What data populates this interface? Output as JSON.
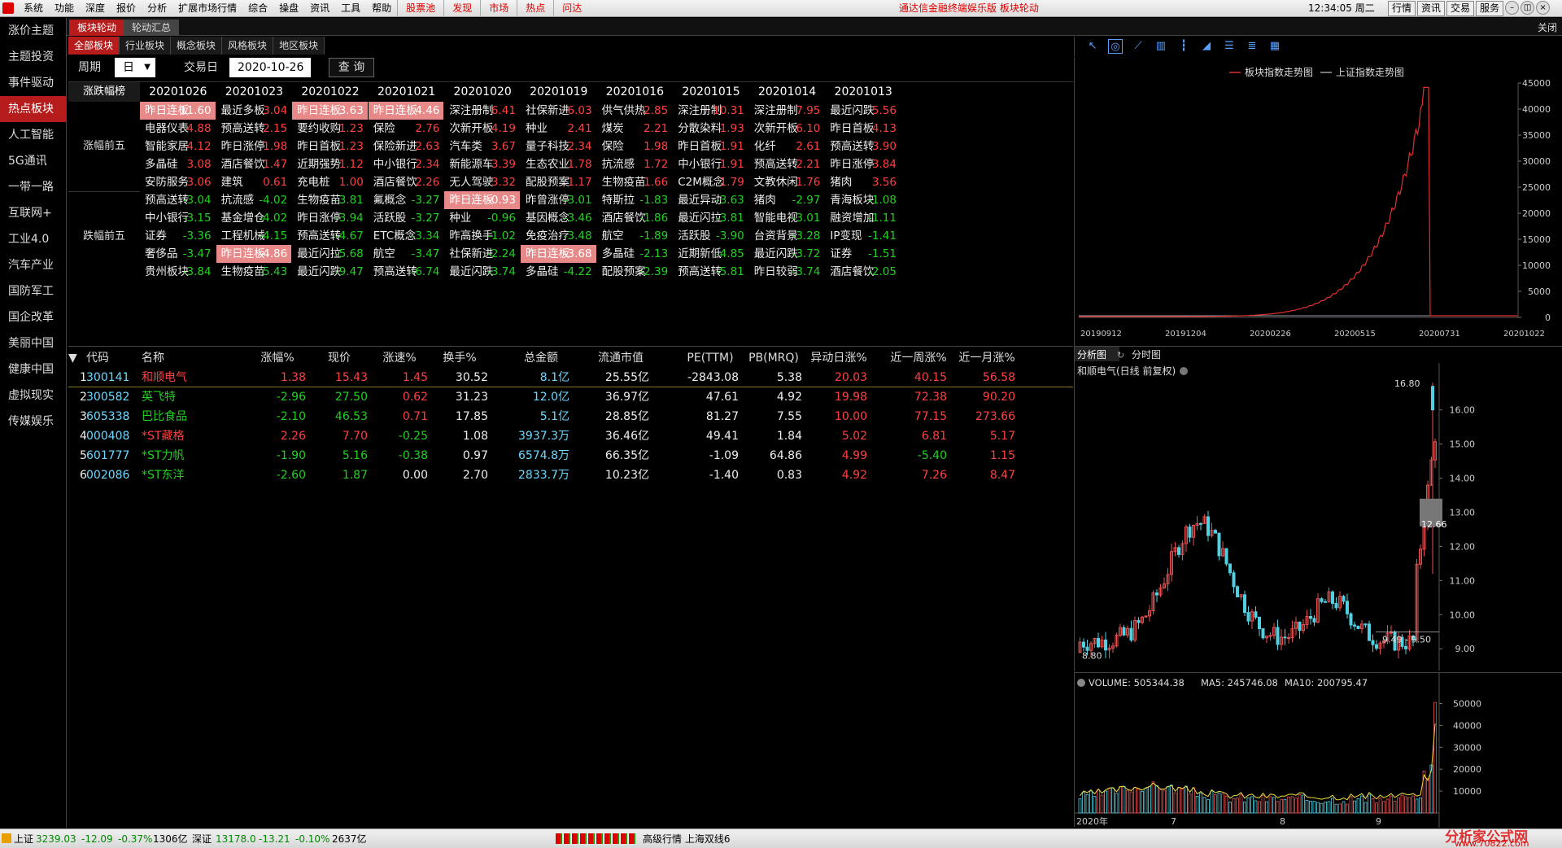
{
  "menubar": {
    "items": [
      "系统",
      "功能",
      "深度",
      "报价",
      "分析",
      "扩展市场行情",
      "综合",
      "操盘",
      "资讯",
      "工具",
      "帮助"
    ],
    "highlights": [
      "股票池",
      "发现",
      "市场",
      "热点",
      "问达"
    ],
    "center": "通达信金融终端娱乐版  板块轮动",
    "time": "12:34:05 周二",
    "right_buttons": [
      "行情",
      "资讯",
      "交易",
      "服务"
    ]
  },
  "tabs": {
    "main": "板块轮动",
    "second": "轮动汇总",
    "close": "关闭"
  },
  "sidebar": {
    "items": [
      "涨价主题",
      "主题投资",
      "事件驱动",
      "热点板块",
      "人工智能",
      "5G通讯",
      "一带一路",
      "互联网+",
      "工业4.0",
      "汽车产业",
      "国防军工",
      "国企改革",
      "美丽中国",
      "健康中国",
      "虚拟现实",
      "传媒娱乐"
    ],
    "active_index": 3
  },
  "subtabs": {
    "items": [
      "全部板块",
      "行业板块",
      "概念板块",
      "风格板块",
      "地区板块"
    ],
    "active_index": 0
  },
  "query": {
    "period_label": "周期",
    "period_value": "日",
    "date_label": "交易日",
    "date_value": "2020-10-26",
    "button": "查 询"
  },
  "rotation": {
    "corner": "涨跌幅榜",
    "up_label": "涨幅前五",
    "down_label": "跌幅前五",
    "dates": [
      "20201026",
      "20201023",
      "20201022",
      "20201021",
      "20201020",
      "20201019",
      "20201016",
      "20201015",
      "20201014",
      "20201013"
    ],
    "up": [
      [
        [
          "昨日连板",
          "11.60",
          1
        ],
        [
          "电器仪表",
          "4.88",
          0
        ],
        [
          "智能家居",
          "4.12",
          0
        ],
        [
          "多晶硅",
          "3.08",
          0
        ],
        [
          "安防服务",
          "3.06",
          0
        ]
      ],
      [
        [
          "最近多板",
          "3.04",
          0
        ],
        [
          "预高送转",
          "2.15",
          0
        ],
        [
          "昨日涨停",
          "1.98",
          0
        ],
        [
          "酒店餐饮",
          "1.47",
          0
        ],
        [
          "建筑",
          "0.61",
          0
        ]
      ],
      [
        [
          "昨日连板",
          "3.63",
          1
        ],
        [
          "要约收购",
          "1.23",
          0
        ],
        [
          "昨日首板",
          "1.23",
          0
        ],
        [
          "近期强势",
          "1.12",
          0
        ],
        [
          "充电桩",
          "1.00",
          0
        ]
      ],
      [
        [
          "昨日连板",
          "4.46",
          1
        ],
        [
          "保险",
          "2.76",
          0
        ],
        [
          "保险新进",
          "2.63",
          0
        ],
        [
          "中小银行",
          "2.34",
          0
        ],
        [
          "酒店餐饮",
          "2.26",
          0
        ]
      ],
      [
        [
          "深注册制",
          "6.41",
          0
        ],
        [
          "次新开板",
          "4.19",
          0
        ],
        [
          "汽车类",
          "3.67",
          0
        ],
        [
          "新能源车",
          "3.39",
          0
        ],
        [
          "无人驾驶",
          "3.32",
          0
        ]
      ],
      [
        [
          "社保新进",
          "6.03",
          0
        ],
        [
          "种业",
          "2.41",
          0
        ],
        [
          "量子科技",
          "2.34",
          0
        ],
        [
          "生态农业",
          "1.78",
          0
        ],
        [
          "配股预案",
          "1.17",
          0
        ]
      ],
      [
        [
          "供气供热",
          "2.85",
          0
        ],
        [
          "煤炭",
          "2.21",
          0
        ],
        [
          "保险",
          "1.98",
          0
        ],
        [
          "抗流感",
          "1.72",
          0
        ],
        [
          "生物疫苗",
          "1.66",
          0
        ]
      ],
      [
        [
          "深注册制",
          "10.31",
          0
        ],
        [
          "分散染料",
          "1.93",
          0
        ],
        [
          "昨日首板",
          "1.91",
          0
        ],
        [
          "中小银行",
          "1.91",
          0
        ],
        [
          "C2M概念",
          "1.79",
          0
        ]
      ],
      [
        [
          "深注册制",
          "7.95",
          0
        ],
        [
          "次新开板",
          "6.10",
          0
        ],
        [
          "化纤",
          "2.61",
          0
        ],
        [
          "预高送转",
          "2.21",
          0
        ],
        [
          "文教休闲",
          "1.76",
          0
        ]
      ],
      [
        [
          "最近闪跌",
          "5.56",
          0
        ],
        [
          "昨日首板",
          "4.13",
          0
        ],
        [
          "预高送转",
          "3.90",
          0
        ],
        [
          "昨日涨停",
          "3.84",
          0
        ],
        [
          "猪肉",
          "3.56",
          0
        ]
      ]
    ],
    "down": [
      [
        [
          "预高送转",
          "-3.04",
          0
        ],
        [
          "中小银行",
          "-3.15",
          0
        ],
        [
          "证券",
          "-3.36",
          0
        ],
        [
          "奢侈品",
          "-3.47",
          0
        ],
        [
          "贵州板块",
          "-3.84",
          0
        ]
      ],
      [
        [
          "抗流感",
          "-4.02",
          0
        ],
        [
          "基金增仓",
          "-4.02",
          0
        ],
        [
          "工程机械",
          "-4.15",
          0
        ],
        [
          "昨日连板",
          "-4.86",
          1
        ],
        [
          "生物疫苗",
          "-5.43",
          0
        ]
      ],
      [
        [
          "生物疫苗",
          "-3.81",
          0
        ],
        [
          "昨日涨停",
          "-3.94",
          0
        ],
        [
          "预高送转",
          "-4.67",
          0
        ],
        [
          "最近闪拉",
          "-5.68",
          0
        ],
        [
          "最近闪跌",
          "-9.47",
          0
        ]
      ],
      [
        [
          "氟概念",
          "-3.27",
          0
        ],
        [
          "活跃股",
          "-3.27",
          0
        ],
        [
          "ETC概念",
          "-3.34",
          0
        ],
        [
          "航空",
          "-3.47",
          0
        ],
        [
          "预高送转",
          "-6.74",
          0
        ]
      ],
      [
        [
          "昨日连板",
          "-0.93",
          1
        ],
        [
          "种业",
          "-0.96",
          0
        ],
        [
          "昨高换手",
          "-1.02",
          0
        ],
        [
          "社保新进",
          "-2.24",
          0
        ],
        [
          "最近闪跌",
          "-3.74",
          0
        ]
      ],
      [
        [
          "昨曾涨停",
          "-3.01",
          0
        ],
        [
          "基因概念",
          "-3.46",
          0
        ],
        [
          "免疫治疗",
          "-3.48",
          0
        ],
        [
          "昨日连板",
          "-3.68",
          1
        ],
        [
          "多晶硅",
          "-4.22",
          0
        ]
      ],
      [
        [
          "特斯拉",
          "-1.83",
          0
        ],
        [
          "酒店餐饮",
          "-1.86",
          0
        ],
        [
          "航空",
          "-1.89",
          0
        ],
        [
          "多晶硅",
          "-2.13",
          0
        ],
        [
          "配股预案",
          "-2.39",
          0
        ]
      ],
      [
        [
          "最近异动",
          "-3.63",
          0
        ],
        [
          "最近闪拉",
          "-3.81",
          0
        ],
        [
          "活跃股",
          "-3.90",
          0
        ],
        [
          "近期新低",
          "-4.85",
          0
        ],
        [
          "预高送转",
          "-5.81",
          0
        ]
      ],
      [
        [
          "猪肉",
          "-2.97",
          0
        ],
        [
          "智能电视",
          "-3.01",
          0
        ],
        [
          "台资背景",
          "-3.28",
          0
        ],
        [
          "最近闪跌",
          "-3.72",
          0
        ],
        [
          "昨日较弱",
          "-3.74",
          0
        ]
      ],
      [
        [
          "青海板块",
          "-1.08",
          0
        ],
        [
          "融资增加",
          "-1.11",
          0
        ],
        [
          "IP变现",
          "-1.41",
          0
        ],
        [
          "证券",
          "-1.51",
          0
        ],
        [
          "酒店餐饮",
          "-2.05",
          0
        ]
      ]
    ]
  },
  "stocks": {
    "headers": [
      "▼",
      "代码",
      "名称",
      "涨幅%",
      "现价",
      "涨速%",
      "换手%",
      "总金额",
      "流通市值",
      "PE(TTM)",
      "PB(MRQ)",
      "异动日涨%",
      "近一周涨%",
      "近一月涨%"
    ],
    "rows": [
      [
        "1",
        "300141",
        "和顺电气",
        "1.38",
        "15.43",
        "1.45",
        "30.52",
        "8.1亿",
        "25.55亿",
        "-2843.08",
        "5.38",
        "20.03",
        "40.15",
        "56.58"
      ],
      [
        "2",
        "300582",
        "英飞特",
        "-2.96",
        "27.50",
        "0.62",
        "31.23",
        "12.0亿",
        "36.97亿",
        "47.61",
        "4.92",
        "19.98",
        "72.38",
        "90.20"
      ],
      [
        "3",
        "605338",
        "巴比食品",
        "-2.10",
        "46.53",
        "0.71",
        "17.85",
        "5.1亿",
        "28.85亿",
        "81.27",
        "7.55",
        "10.00",
        "77.15",
        "273.66"
      ],
      [
        "4",
        "000408",
        "*ST藏格",
        "2.26",
        "7.70",
        "-0.25",
        "1.08",
        "3937.3万",
        "36.46亿",
        "49.41",
        "1.84",
        "5.02",
        "6.81",
        "5.17"
      ],
      [
        "5",
        "601777",
        "*ST力帆",
        "-1.90",
        "5.16",
        "-0.38",
        "0.97",
        "6574.8万",
        "66.35亿",
        "-1.09",
        "64.86",
        "4.99",
        "-5.40",
        "1.15"
      ],
      [
        "6",
        "002086",
        "*ST东洋",
        "-2.60",
        "1.87",
        "0.00",
        "2.70",
        "2833.7万",
        "10.23亿",
        "-1.40",
        "0.83",
        "4.92",
        "7.26",
        "8.47"
      ]
    ]
  },
  "trend_chart": {
    "legend": [
      "板块指数走势图",
      "上证指数走势图"
    ],
    "colors": {
      "sector": "#e03030",
      "sh": "#9aa0a8"
    },
    "y_ticks": [
      "45000",
      "40000",
      "35000",
      "30000",
      "25000",
      "20000",
      "15000",
      "10000",
      "5000",
      "0"
    ],
    "x_ticks": [
      "20190912",
      "20191204",
      "20200226",
      "20200515",
      "20200731",
      "20201022"
    ]
  },
  "kline": {
    "tabs": [
      "分析图",
      "分时图"
    ],
    "title": "和顺电气(日线 前复权)",
    "y_ticks": [
      "16.00",
      "15.00",
      "14.00",
      "13.00",
      "12.00",
      "11.00",
      "10.00",
      "9.00"
    ],
    "high_label": "16.80",
    "low_label": "8.80",
    "range_label": "9.49 - 9.50",
    "price_label": "12.66"
  },
  "volume": {
    "label_volume": "VOLUME: 505344.38",
    "label_ma5": "MA5: 245746.08",
    "label_ma10": "MA10: 200795.47",
    "y_ticks": [
      "50000",
      "40000",
      "30000",
      "20000",
      "10000"
    ],
    "x_ticks": [
      "2020年",
      "7",
      "8",
      "9"
    ]
  },
  "status": {
    "sh_name": "上证",
    "sh_value": "3239.03",
    "sh_change": "-12.09",
    "sh_pct": "-0.37%",
    "sh_amount": "1306亿",
    "sz_name": "深证",
    "sz_value": "13178.0",
    "sz_change": "-13.21",
    "sz_pct": "-0.10%",
    "sz_amount": "2637亿",
    "feed": "高级行情  上海双线6",
    "watermark": "分析家公式网",
    "watermark_url": "www.70822.com"
  }
}
